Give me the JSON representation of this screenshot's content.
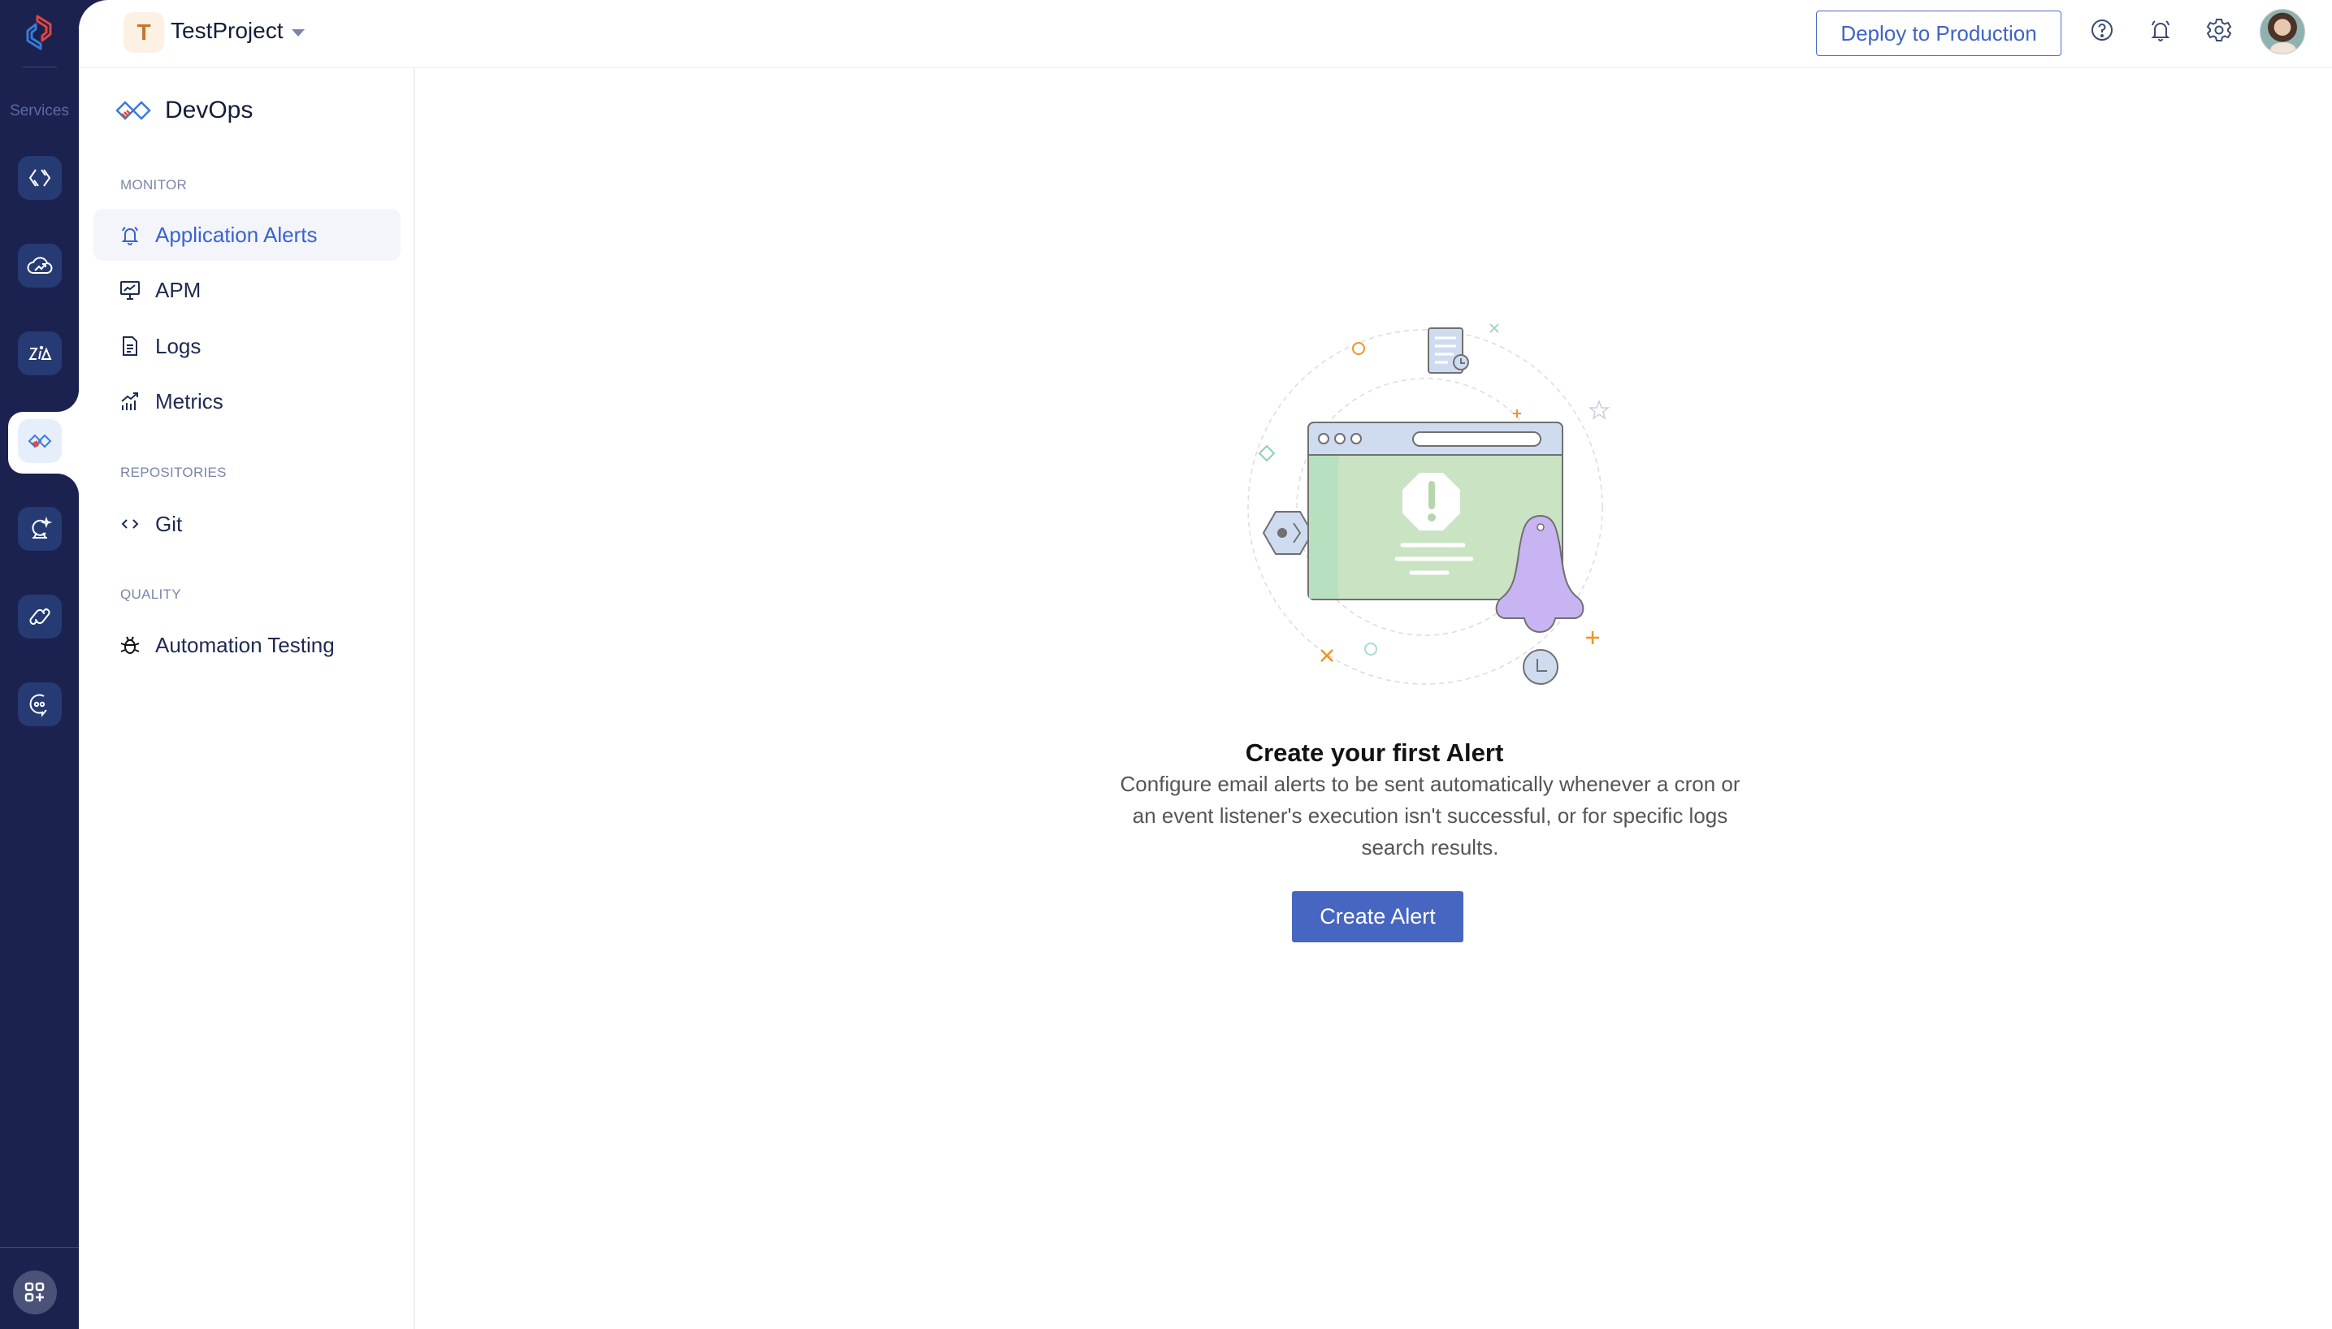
{
  "rail": {
    "label": "Services",
    "items": [
      {
        "name": "code-studio",
        "icon": "code-brackets-icon",
        "active": false
      },
      {
        "name": "cloud-scale",
        "icon": "cloud-trend-icon",
        "active": false
      },
      {
        "name": "zia",
        "icon": "zia-icon",
        "active": false
      },
      {
        "name": "devops",
        "icon": "devops-icon",
        "active": true
      },
      {
        "name": "ai-services",
        "icon": "crystal-ball-icon",
        "active": false
      },
      {
        "name": "integrations",
        "icon": "link-icon",
        "active": false
      },
      {
        "name": "chat",
        "icon": "chat-bubble-icon",
        "active": false
      }
    ],
    "apps_button": "apps-add-icon"
  },
  "header": {
    "project_initial": "T",
    "project_name": "TestProject",
    "deploy_label": "Deploy to Production",
    "icons": [
      "help-icon",
      "bell-icon",
      "gear-icon"
    ]
  },
  "sidebar": {
    "title": "DevOps",
    "sections": [
      {
        "label": "MONITOR",
        "items": [
          {
            "label": "Application Alerts",
            "icon": "bell-icon",
            "active": true
          },
          {
            "label": "APM",
            "icon": "monitor-chart-icon",
            "active": false
          },
          {
            "label": "Logs",
            "icon": "document-icon",
            "active": false
          },
          {
            "label": "Metrics",
            "icon": "bar-chart-icon",
            "active": false
          }
        ]
      },
      {
        "label": "REPOSITORIES",
        "items": [
          {
            "label": "Git",
            "icon": "code-icon",
            "active": false
          }
        ]
      },
      {
        "label": "QUALITY",
        "items": [
          {
            "label": "Automation Testing",
            "icon": "bug-icon",
            "active": false
          }
        ]
      }
    ]
  },
  "empty_state": {
    "title": "Create your first Alert",
    "description": "Configure email alerts to be sent automatically whenever a cron or an event listener's execution isn't successful, or for specific logs search results.",
    "button_label": "Create Alert"
  },
  "colors": {
    "rail_bg": "#1b2250",
    "accent": "#4766c1",
    "active_text": "#3a63d2"
  }
}
